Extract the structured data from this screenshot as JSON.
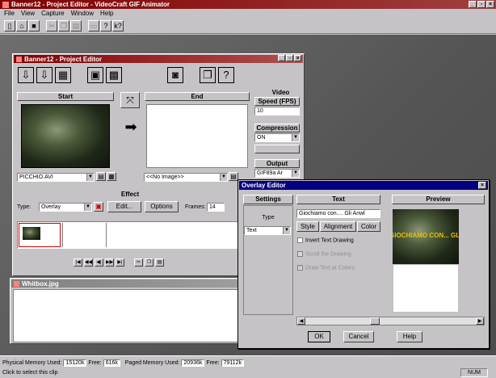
{
  "app_window": {
    "title": "Banner12 - Project Editor - VideoCraft GIF Animator",
    "menu": [
      "File",
      "View",
      "Capture",
      "Window",
      "Help"
    ],
    "controls": [
      "_",
      "▫",
      "×"
    ]
  },
  "editor": {
    "title": "Banner12 - Project Editor",
    "start_label": "Start",
    "end_label": "End",
    "start_file": "PICCHIO.AVI",
    "end_file": "<<No Image>>",
    "video_label": "Video",
    "speed_label": "Speed (FPS)",
    "speed_value": "10",
    "compression_label": "Compression",
    "compression_value": "ON",
    "output_label": "Output",
    "output_value": "GIF89a Ar",
    "effect_label": "Effect",
    "type_label": "Type:",
    "type_value": "Overlay",
    "edit_label": "Edit...",
    "options_label": "Options",
    "frames_label": "Frames:",
    "frames_value": "14"
  },
  "bitmap_window": {
    "title": "Whitbox.jpg"
  },
  "overlay_dialog": {
    "title": "Overlay Editor",
    "settings_label": "Settings",
    "text_header": "Text",
    "preview_label": "Preview",
    "type_label": "Type",
    "type_value": "Text",
    "text_value": "Giochiamo con.... Gli Anwl",
    "style_label": "Style",
    "alignment_label": "Alignment",
    "color_label": "Color",
    "invert_label": "Invert Text Drawing",
    "opt2_label": "Scroll the Drawing",
    "opt3_label": "Draw Text at Colors",
    "preview_text": "GIOCHIAMO CON... GLI A",
    "ok_label": "OK",
    "cancel_label": "Cancel",
    "help_label": "Help"
  },
  "status": {
    "physical_label": "Physical Memory Used:",
    "physical_used": "15120k",
    "physical_free_label": "Free:",
    "physical_free": "616k",
    "paged_label": "Paged Memory Used:",
    "paged_used": "20936k",
    "paged_free_label": "Free:",
    "paged_free": "79112k",
    "hint": "Click to select this clip",
    "num": "NUM"
  },
  "colors": {
    "titlebar": "#800000",
    "desktop": "#5a5a5a",
    "dialog_title": "#000080"
  }
}
